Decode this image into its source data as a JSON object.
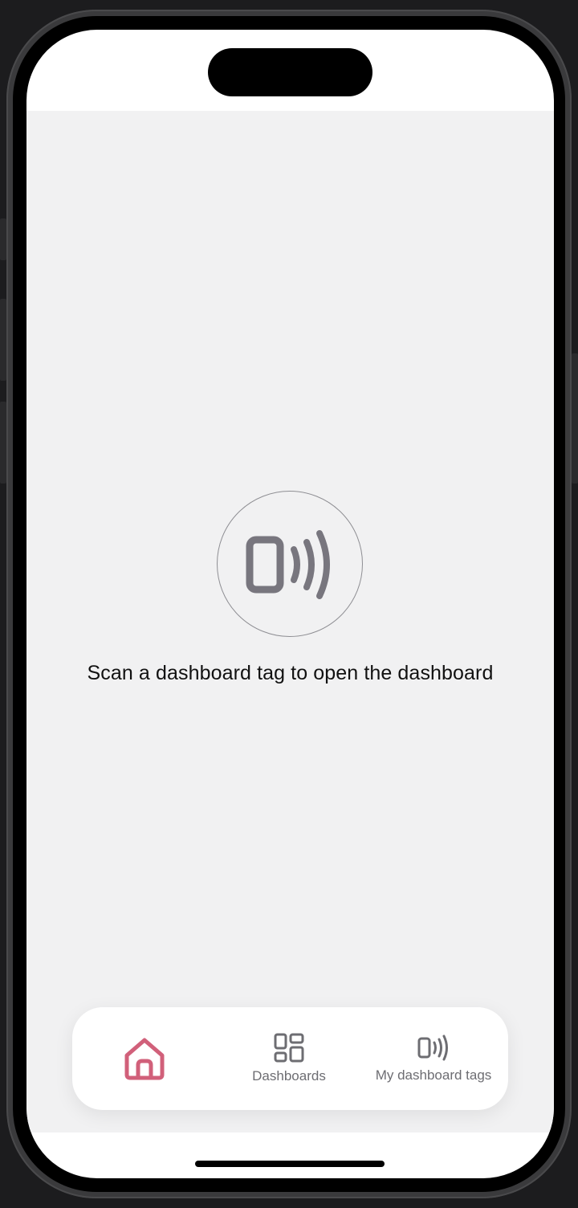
{
  "main": {
    "scan_message": "Scan a dashboard tag to open the dashboard",
    "scan_icon": "nfc-phone-icon"
  },
  "tabbar": {
    "tabs": [
      {
        "label": "",
        "icon": "home-icon",
        "active": true
      },
      {
        "label": "Dashboards",
        "icon": "dashboard-grid-icon",
        "active": false
      },
      {
        "label": "My dashboard tags",
        "icon": "nfc-tag-icon",
        "active": false
      }
    ]
  },
  "colors": {
    "accent": "#d1607a",
    "icon_gray": "#78767e",
    "background": "#f1f1f2"
  }
}
